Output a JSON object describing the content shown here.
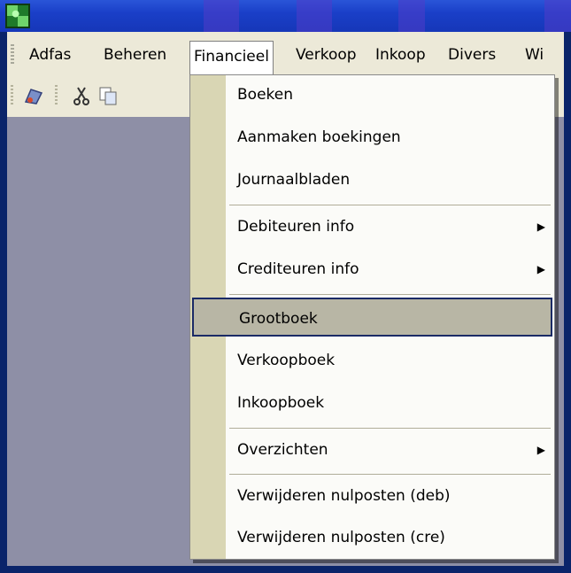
{
  "menubar": {
    "items": [
      "Adfas",
      "Beheren",
      "Financieel",
      "Verkoop",
      "Inkoop",
      "Divers",
      "Wi"
    ]
  },
  "toolbar": {
    "icons": [
      "app-tool-icon",
      "cut-icon",
      "copy-icon"
    ]
  },
  "dropdown": {
    "items": [
      {
        "label": "Boeken",
        "submenu": false
      },
      {
        "label": "Aanmaken boekingen",
        "submenu": false
      },
      {
        "label": "Journaalbladen",
        "submenu": false
      },
      {
        "label": "Debiteuren info",
        "submenu": true
      },
      {
        "label": "Crediteuren info",
        "submenu": true
      },
      {
        "label": "Grootboek",
        "submenu": false,
        "selected": true
      },
      {
        "label": "Verkoopboek",
        "submenu": false
      },
      {
        "label": "Inkoopboek",
        "submenu": false
      },
      {
        "label": "Overzichten",
        "submenu": true
      },
      {
        "label": "Verwijderen nulposten (deb)",
        "submenu": false
      },
      {
        "label": "Verwijderen nulposten (cre)",
        "submenu": false
      }
    ],
    "arrow": "▶"
  },
  "colors": {
    "titlebar": "#1f44c8",
    "menubar": "#ece9d8",
    "client": "#8e8fa6",
    "selection": "#b8b6a5",
    "gutter": "#d9d6b4"
  }
}
